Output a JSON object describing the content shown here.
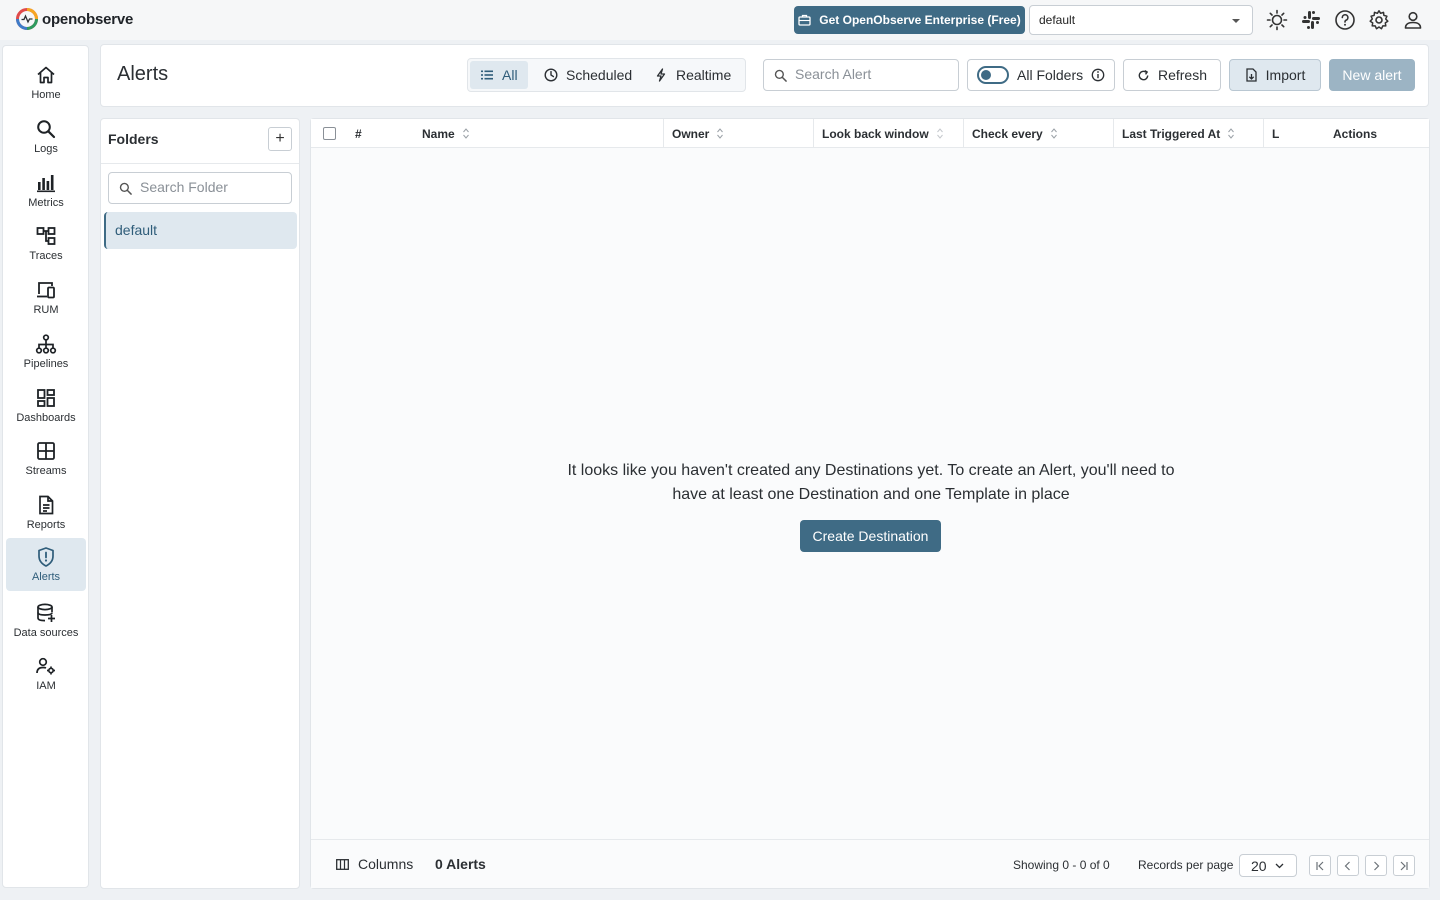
{
  "app": {
    "logo_text": "openobserve"
  },
  "topbar": {
    "enterprise_label": "Get OpenObserve Enterprise (Free)",
    "org_selected": "default",
    "icons": [
      "sun-icon",
      "slack-icon",
      "help-icon",
      "settings-icon",
      "user-icon"
    ]
  },
  "nav": {
    "items": [
      {
        "label": "Home",
        "icon": "home-icon"
      },
      {
        "label": "Logs",
        "icon": "search-icon"
      },
      {
        "label": "Metrics",
        "icon": "bar-chart-icon"
      },
      {
        "label": "Traces",
        "icon": "traces-icon"
      },
      {
        "label": "RUM",
        "icon": "devices-icon"
      },
      {
        "label": "Pipelines",
        "icon": "pipelines-icon"
      },
      {
        "label": "Dashboards",
        "icon": "dashboard-icon"
      },
      {
        "label": "Streams",
        "icon": "streams-icon"
      },
      {
        "label": "Reports",
        "icon": "document-icon"
      },
      {
        "label": "Alerts",
        "icon": "shield-alert-icon"
      },
      {
        "label": "Data sources",
        "icon": "database-add-icon"
      },
      {
        "label": "IAM",
        "icon": "iam-icon"
      }
    ],
    "active": "Alerts"
  },
  "header": {
    "title": "Alerts",
    "tabs": [
      {
        "label": "All",
        "icon": "list-icon"
      },
      {
        "label": "Scheduled",
        "icon": "clock-icon"
      },
      {
        "label": "Realtime",
        "icon": "bolt-icon"
      }
    ],
    "active_tab": "All",
    "search_placeholder": "Search Alert",
    "all_folders_label": "All Folders",
    "refresh_label": "Refresh",
    "import_label": "Import",
    "new_alert_label": "New alert"
  },
  "folders": {
    "title": "Folders",
    "add_label": "+",
    "search_placeholder": "Search Folder",
    "items": [
      "default"
    ],
    "selected": "default"
  },
  "table": {
    "columns": [
      "#",
      "Name",
      "Owner",
      "Look back window",
      "Check every",
      "Last Triggered At",
      "L",
      "Actions"
    ],
    "rows": [],
    "empty_message": "It looks like you haven't created any Destinations yet. To create an Alert, you'll need to have at least one Destination and one Template in place",
    "create_destination_label": "Create Destination"
  },
  "footer": {
    "columns_label": "Columns",
    "alert_count": "0 Alerts",
    "showing": "Showing 0 - 0 of 0",
    "records_per_page_label": "Records per page",
    "records_per_page": "20"
  },
  "colors": {
    "primary": "#3f6b85",
    "active_bg": "#dfe8ef",
    "disabled": "#9cb4c4"
  }
}
